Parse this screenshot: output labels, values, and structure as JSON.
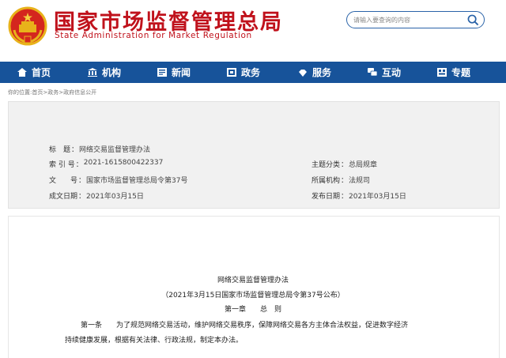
{
  "header": {
    "title": "国家市场监督管理总局",
    "subtitle": "State Administration for Market Regulation",
    "emblem_icon": "national-emblem-icon"
  },
  "search": {
    "placeholder": "请输入要查询的内容",
    "icon": "search-icon"
  },
  "nav": {
    "items": [
      {
        "label": "首页",
        "icon": "home-icon"
      },
      {
        "label": "机构",
        "icon": "institution-icon"
      },
      {
        "label": "新闻",
        "icon": "news-icon"
      },
      {
        "label": "政务",
        "icon": "government-affairs-icon"
      },
      {
        "label": "服务",
        "icon": "service-icon"
      },
      {
        "label": "互动",
        "icon": "interaction-icon"
      },
      {
        "label": "专题",
        "icon": "topic-icon"
      }
    ]
  },
  "breadcrumb": "你的位置:首页>政务>政府信息公开",
  "info": {
    "title_label": "标　题",
    "title_value": "网络交易监督管理办法",
    "index_label": "索 引 号",
    "index_value": "2021-16158004223​37",
    "docno_label": "文　　号",
    "docno_value": "国家市场监督管理总局令第37号",
    "created_label": "成文日期",
    "created_value": "2021年03月15日",
    "category_label": "主题分类",
    "category_value": "总局规章",
    "org_label": "所属机构",
    "org_value": "法规司",
    "published_label": "发布日期",
    "published_value": "2021年03月15日"
  },
  "document": {
    "title": "网络交易监督管理办法",
    "issue": "（2021年3月15日国家市场监督管理总局令第37号公布）",
    "chapter": "第一章　　总　则",
    "para1": "第一条　　为了规范网络交易活动，维护网络交易秩序，保障网络交易各方主体合法权益，促进数字经济",
    "para2": "持续健康发展，根据有关法律、行政法规，制定本办法。"
  },
  "colors": {
    "brand_red": "#c0121c",
    "nav_blue": "#17539a"
  }
}
